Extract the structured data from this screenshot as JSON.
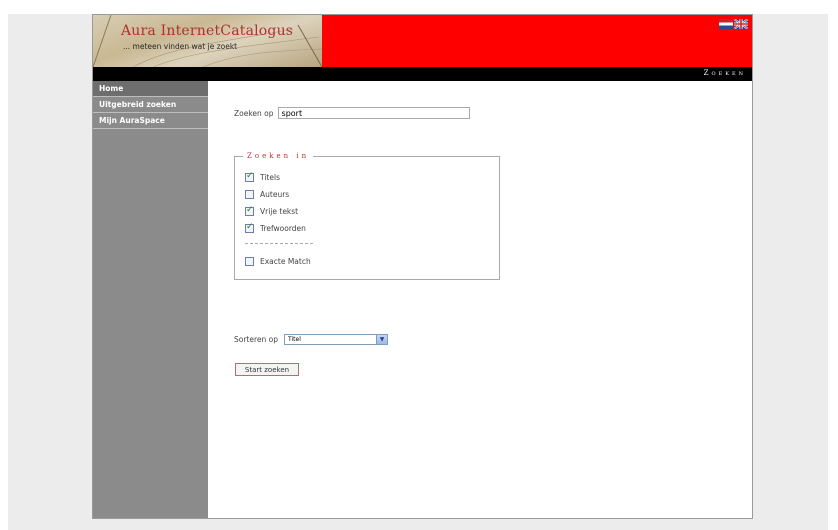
{
  "header": {
    "logo_title": "Aura InternetCatalogus",
    "logo_subtitle": "... meteen vinden wat je zoekt",
    "flags": [
      "flag-nl",
      "flag-uk"
    ]
  },
  "titlebar": {
    "text": "Zoeken"
  },
  "sidebar": {
    "items": [
      {
        "label": "Home"
      },
      {
        "label": "Uitgebreid zoeken"
      },
      {
        "label": "Mijn AuraSpace"
      }
    ]
  },
  "search": {
    "label": "Zoeken op",
    "value": "sport"
  },
  "zoeken_in": {
    "legend": "Zoeken in",
    "options": [
      {
        "label": "Titels",
        "checked": true
      },
      {
        "label": "Auteurs",
        "checked": false
      },
      {
        "label": "Vrije tekst",
        "checked": true
      },
      {
        "label": "Trefwoorden",
        "checked": true
      }
    ],
    "exact_match": {
      "label": "Exacte Match",
      "checked": false
    }
  },
  "sort": {
    "label": "Sorteren op",
    "selected": "Titel"
  },
  "start_button": {
    "label": "Start zoeken"
  },
  "colors": {
    "header_red": "#ff0000",
    "sidebar_gray": "#8b8b8b",
    "legend_red": "#c03030"
  }
}
